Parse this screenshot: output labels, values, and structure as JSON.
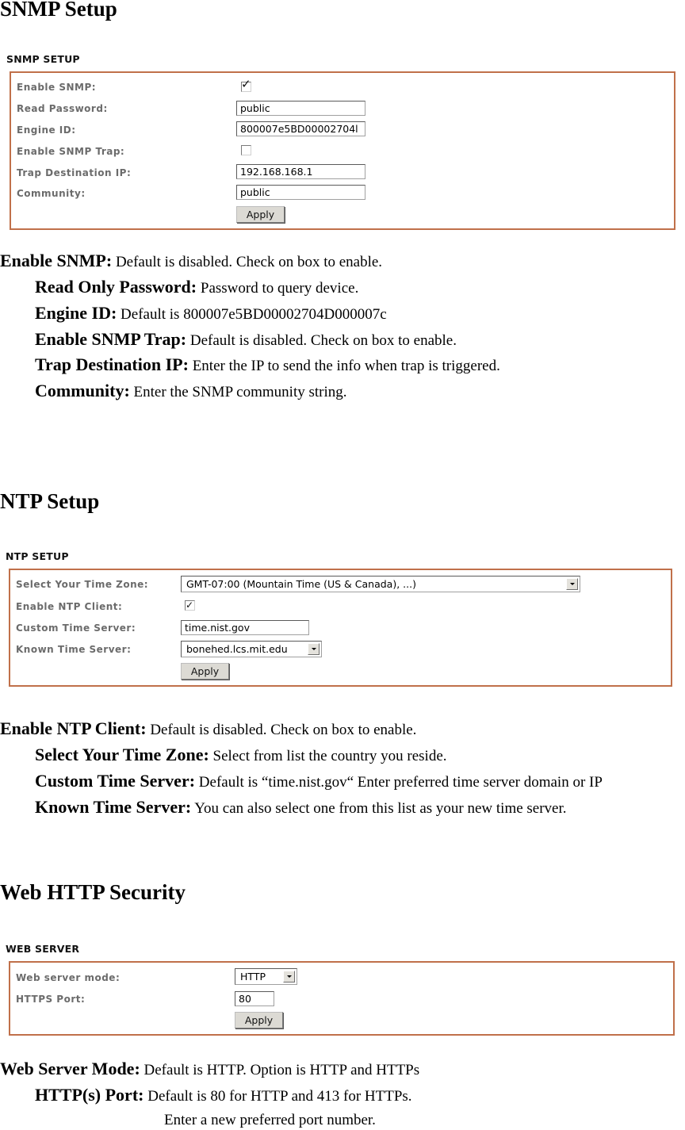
{
  "snmp": {
    "title": "SNMP Setup",
    "panel_caption": "SNMP SETUP",
    "fields": {
      "enable_snmp": {
        "label": "Enable SNMP:",
        "checked": true
      },
      "read_password": {
        "label": "Read Password:",
        "value": "public"
      },
      "engine_id": {
        "label": "Engine ID:",
        "value": "800007e5BD00002704l"
      },
      "enable_trap": {
        "label": "Enable SNMP Trap:",
        "checked": false
      },
      "trap_ip": {
        "label": "Trap Destination IP:",
        "value": "192.168.168.1"
      },
      "community": {
        "label": "Community:",
        "value": "public"
      }
    },
    "apply_label": "Apply",
    "descriptions": [
      {
        "term": "Enable SNMP:",
        "text": " Default is disabled. Check on box to enable."
      },
      {
        "term": "Read Only Password:",
        "text": " Password to query device."
      },
      {
        "term": "Engine ID:",
        "text": " Default is 800007e5BD00002704D000007c"
      },
      {
        "term": "Enable SNMP Trap:",
        "text": " Default is disabled. Check on box to enable."
      },
      {
        "term": "Trap Destination IP:",
        "text": " Enter the IP to send the info when trap is triggered."
      },
      {
        "term": "Community:",
        "text": " Enter the SNMP community string."
      }
    ]
  },
  "ntp": {
    "title": "NTP Setup",
    "panel_caption": "NTP SETUP",
    "fields": {
      "time_zone": {
        "label": "Select Your Time Zone:",
        "value": "GMT-07:00 (Mountain Time (US & Canada), ...)"
      },
      "enable_ntp": {
        "label": "Enable NTP Client:",
        "checked": true
      },
      "custom_server": {
        "label": "Custom Time Server:",
        "value": "time.nist.gov"
      },
      "known_server": {
        "label": "Known Time Server:",
        "value": "bonehed.lcs.mit.edu"
      }
    },
    "apply_label": "Apply",
    "descriptions": [
      {
        "term": "Enable NTP Client:",
        "text": " Default is disabled. Check on box to enable."
      },
      {
        "term": "Select Your Time Zone:",
        "text": " Select from list the country you reside."
      },
      {
        "term": "Custom Time Server:",
        "text": " Default is “time.nist.gov“ Enter preferred time server domain or IP"
      },
      {
        "term": "Known Time Server:",
        "text": " You can also select one from this list as your new time server."
      }
    ]
  },
  "web": {
    "title": "Web HTTP Security",
    "panel_caption": "WEB SERVER",
    "fields": {
      "mode": {
        "label": "Web server mode:",
        "value": "HTTP"
      },
      "port": {
        "label": "HTTPS Port:",
        "value": "80"
      }
    },
    "apply_label": "Apply",
    "descriptions": [
      {
        "term": "Web Server Mode:",
        "text": " Default is HTTP. Option is HTTP and HTTPs"
      },
      {
        "term": "HTTP(s) Port:",
        "text": " Default is 80 for HTTP and 413 for HTTPs."
      },
      {
        "term": "",
        "text": "Enter a new preferred port number."
      }
    ]
  },
  "icons": {
    "checkmark": "✓",
    "dropdown_arrow": "triangle-down"
  }
}
